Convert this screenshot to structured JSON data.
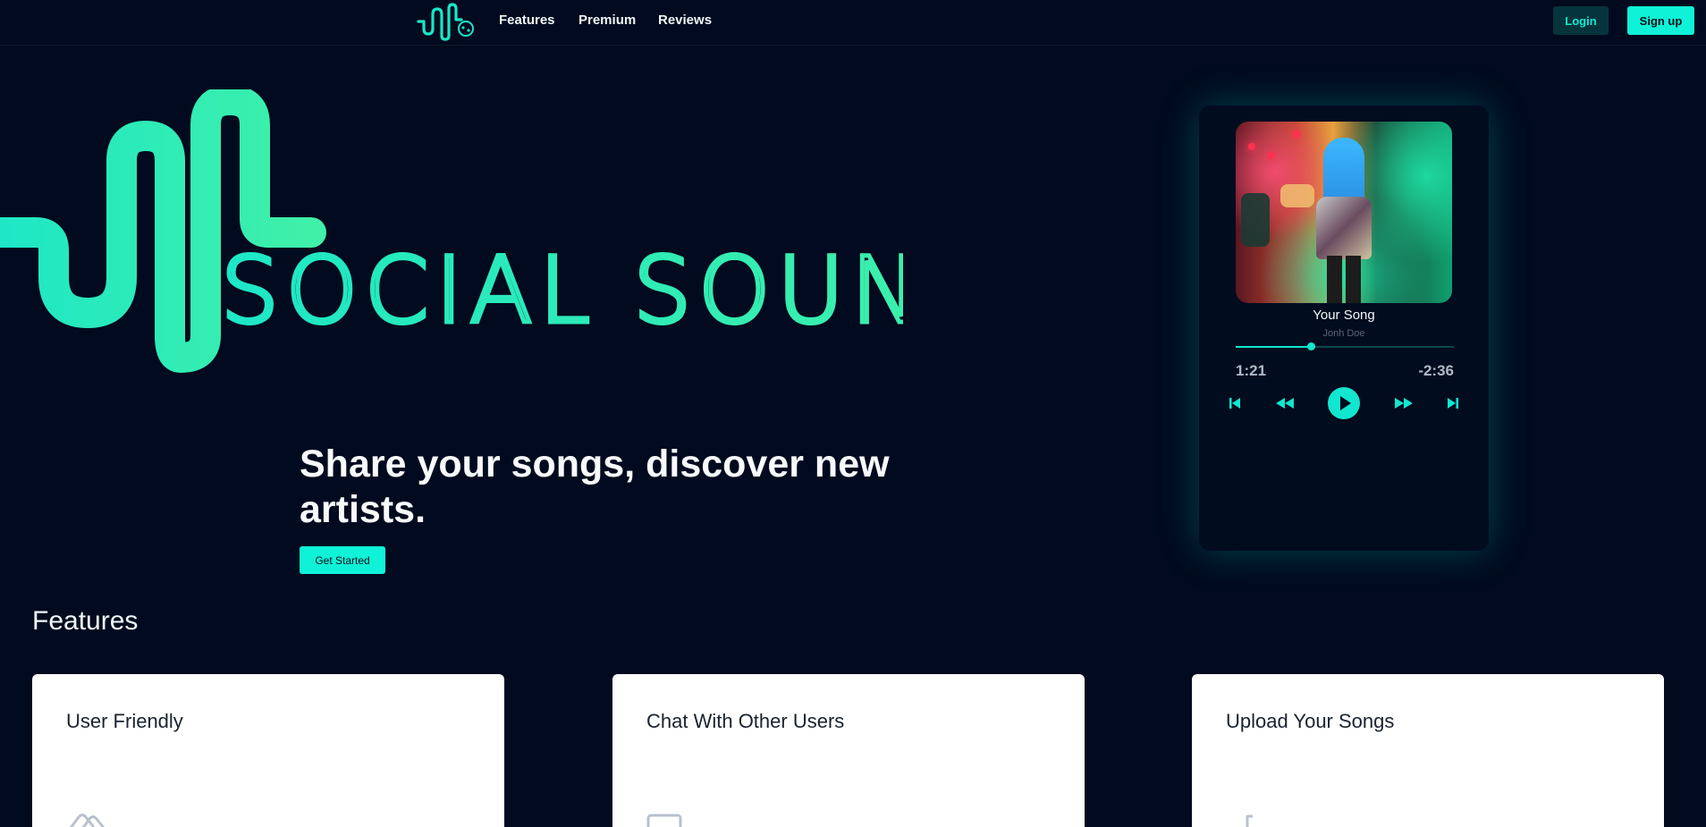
{
  "nav": {
    "links": [
      "Features",
      "Premium",
      "Reviews"
    ],
    "login_label": "Login",
    "signup_label": "Sign up"
  },
  "hero": {
    "logo_text": "SOCIAL SOUND",
    "tagline": "Share your songs, discover new artists.",
    "cta_label": "Get Started"
  },
  "player": {
    "song_title": "Your Song",
    "artist": "Jonh Doe",
    "elapsed": "1:21",
    "remaining": "-2:36",
    "progress": 0.345,
    "controls": [
      "skip-back-icon",
      "rewind-icon",
      "play-icon",
      "fast-forward-icon",
      "skip-forward-icon"
    ]
  },
  "features": {
    "heading": "Features",
    "cards": [
      {
        "title": "User Friendly",
        "icon": "hands-icon"
      },
      {
        "title": "Chat With Other Users",
        "icon": "chat-icon"
      },
      {
        "title": "Upload Your Songs",
        "icon": "music-note-icon"
      }
    ]
  },
  "colors": {
    "background": "#010a1e",
    "accent": "#0ff2d8",
    "login_bg": "#06343c",
    "card_bg": "#ffffff"
  }
}
